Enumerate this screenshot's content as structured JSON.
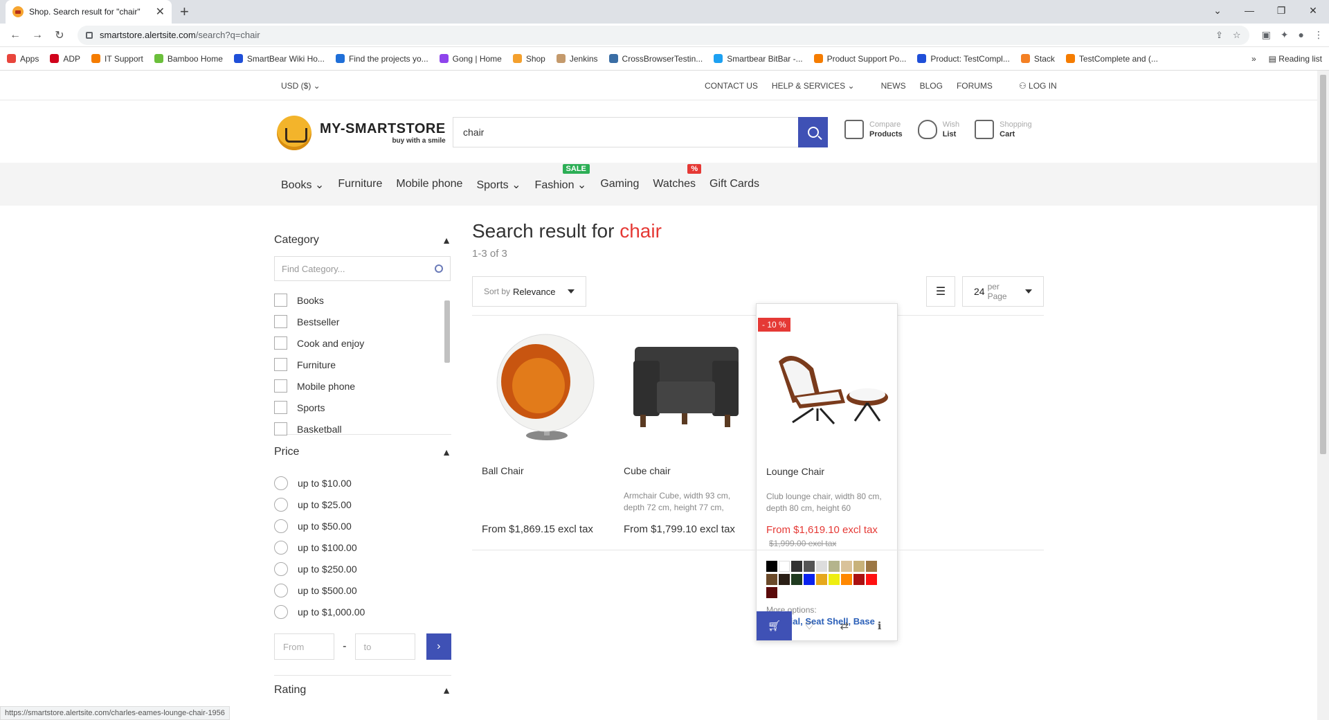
{
  "browser": {
    "tab_title": "Shop. Search result for \"chair\"",
    "url_host": "smartstore.alertsite.com",
    "url_path": "/search?q=chair",
    "bookmarks": [
      {
        "label": "Apps",
        "color": "#e8453c"
      },
      {
        "label": "ADP",
        "color": "#d0021b"
      },
      {
        "label": "IT Support",
        "color": "#f57c00"
      },
      {
        "label": "Bamboo Home",
        "color": "#6bbf3b"
      },
      {
        "label": "SmartBear Wiki Ho...",
        "color": "#1f4fd8"
      },
      {
        "label": "Find the projects yo...",
        "color": "#1f6fd8"
      },
      {
        "label": "Gong | Home",
        "color": "#8e44ec"
      },
      {
        "label": "Shop",
        "color": "#f4a02d"
      },
      {
        "label": "Jenkins",
        "color": "#c49a6c"
      },
      {
        "label": "CrossBrowserTestin...",
        "color": "#3a6ea5"
      },
      {
        "label": "Smartbear BitBar -...",
        "color": "#1da1f2"
      },
      {
        "label": "Product Support Po...",
        "color": "#f57c00"
      },
      {
        "label": "Product: TestCompl...",
        "color": "#1f4fd8"
      },
      {
        "label": "Stack",
        "color": "#f48024"
      },
      {
        "label": "TestComplete and (...",
        "color": "#f57c00"
      }
    ],
    "reading_list": "Reading list",
    "status_url": "https://smartstore.alertsite.com/charles-eames-lounge-chair-1956"
  },
  "topbar": {
    "currency": "USD ($)",
    "contact": "CONTACT US",
    "help": "HELP & SERVICES",
    "news": "NEWS",
    "blog": "BLOG",
    "forums": "FORUMS",
    "login": "LOG IN"
  },
  "header": {
    "logo_name": "MY-SMARTSTORE",
    "logo_tag": "buy with a smile",
    "search_value": "chair",
    "compare_l1": "Compare",
    "compare_l2": "Products",
    "wish_l1": "Wish",
    "wish_l2": "List",
    "cart_l1": "Shopping",
    "cart_l2": "Cart"
  },
  "nav": {
    "items": [
      "Books",
      "Furniture",
      "Mobile phone",
      "Sports",
      "Fashion",
      "Gaming",
      "Watches",
      "Gift Cards"
    ],
    "sale_badge": "SALE",
    "pct_badge": "%"
  },
  "sidebar": {
    "category_title": "Category",
    "find_placeholder": "Find Category...",
    "categories": [
      "Books",
      "Bestseller",
      "Cook and enjoy",
      "Furniture",
      "Mobile phone",
      "Sports",
      "Basketball"
    ],
    "price_title": "Price",
    "prices": [
      "up to $10.00",
      "up to $25.00",
      "up to $50.00",
      "up to $100.00",
      "up to $250.00",
      "up to $500.00",
      "up to $1,000.00"
    ],
    "from_placeholder": "From",
    "to_placeholder": "to",
    "rating_title": "Rating"
  },
  "main": {
    "title_prefix": "Search result for",
    "query": "chair",
    "count": "1-3 of 3",
    "sort_prefix": "Sort by",
    "sort_value": "Relevance",
    "per_page_value": "24",
    "per_page_label": "per Page"
  },
  "products": [
    {
      "name": "Ball Chair",
      "desc": "",
      "price": "From $1,869.15 excl tax"
    },
    {
      "name": "Cube chair",
      "desc": "Armchair Cube, width 93 cm, depth 72 cm, height 77 cm,",
      "price": "From $1,799.10 excl tax"
    },
    {
      "name": "Lounge Chair",
      "desc": "Club lounge chair, width 80 cm, depth 80 cm, height 60",
      "price": "From $1,619.10 excl tax",
      "old_price": "$1,999.00 excl tax",
      "discount": "- 10 %",
      "more_options": "More options:",
      "more_links": "Material, Seat Shell, Base"
    }
  ],
  "swatch_colors": [
    "#000000",
    "#ffffff",
    "#333333",
    "#555555",
    "#dddddd",
    "#b4b48c",
    "#d9c29a",
    "#c8b27a",
    "#9c7744",
    "#6b4a2a",
    "#2a1f16",
    "#1f3a1f",
    "#0a22ee",
    "#e6a81c",
    "#eeee11",
    "#ff8800",
    "#aa1111",
    "#ff1111",
    "#5a0a0a"
  ]
}
